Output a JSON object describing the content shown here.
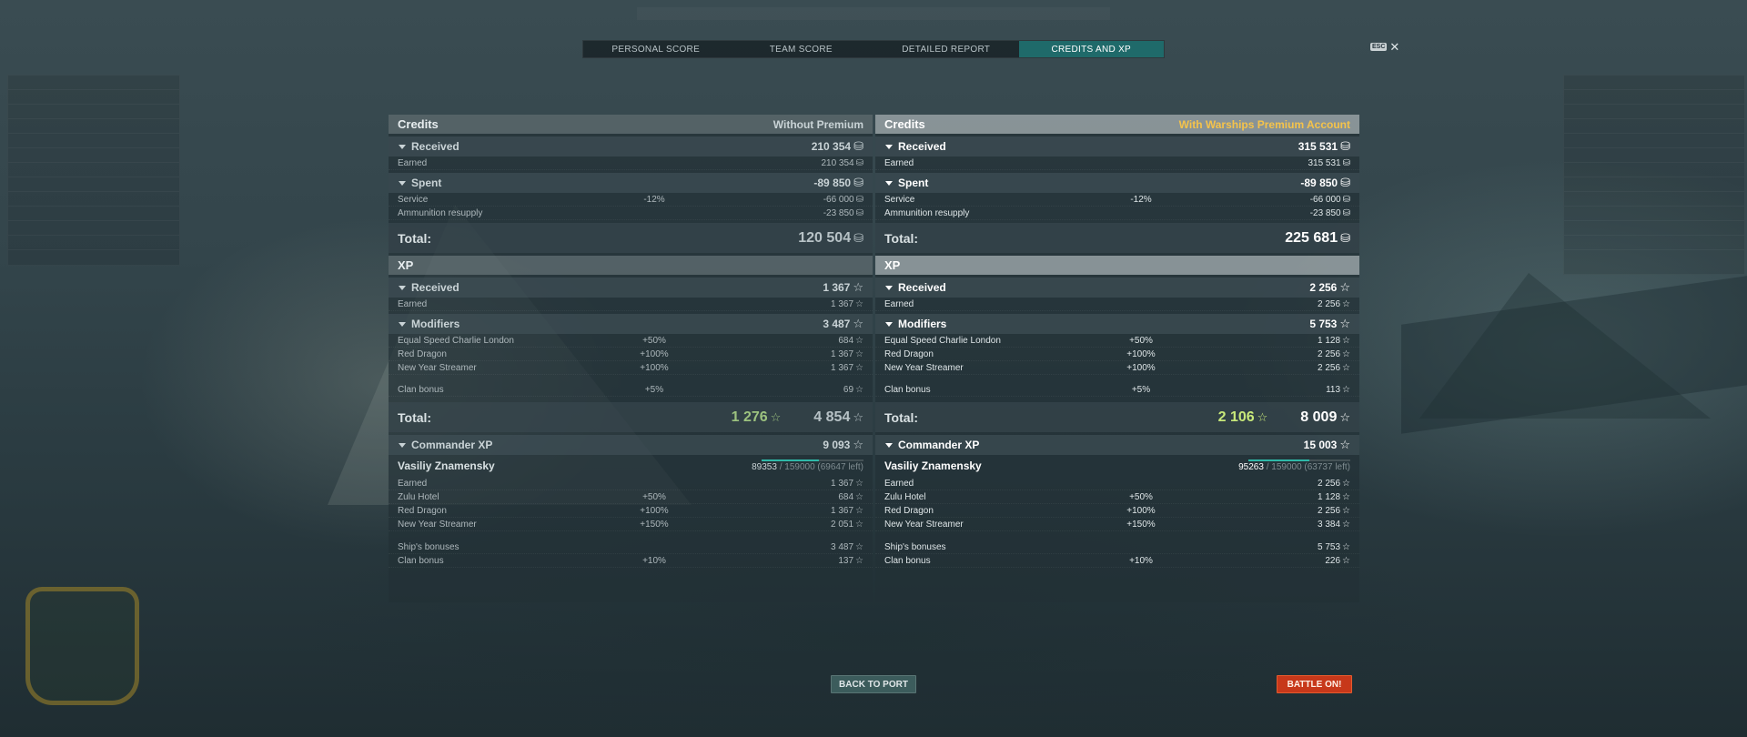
{
  "tabs": [
    {
      "label": "PERSONAL SCORE"
    },
    {
      "label": "TEAM SCORE"
    },
    {
      "label": "DETAILED REPORT"
    },
    {
      "label": "CREDITS AND XP"
    }
  ],
  "esc": {
    "badge": "ESC",
    "close": "✕"
  },
  "colors": {
    "accent": "#1f6a6a",
    "premium": "#f5c34a",
    "battle": "#c7381a",
    "xp_base": "#9cc27f"
  },
  "icons": {
    "credits": "credits-icon",
    "xp": "star-icon"
  },
  "left": {
    "credits_header": "Credits",
    "credits_sub": "Without Premium",
    "received": {
      "label": "Received",
      "value": "210 354"
    },
    "earned": {
      "label": "Earned",
      "value": "210 354"
    },
    "spent": {
      "label": "Spent",
      "value": "-89 850"
    },
    "service": {
      "label": "Service",
      "mod": "-12%",
      "value": "-66 000"
    },
    "ammo": {
      "label": "Ammunition resupply",
      "value": "-23 850"
    },
    "total_label": "Total:",
    "total_credits": "120 504",
    "xp_header": "XP",
    "xp_received": {
      "label": "Received",
      "value": "1 367"
    },
    "xp_earned": {
      "label": "Earned",
      "value": "1 367"
    },
    "modifiers": {
      "label": "Modifiers",
      "value": "3 487"
    },
    "mod_rows": [
      {
        "label": "Equal Speed Charlie London",
        "mod": "+50%",
        "value": "684"
      },
      {
        "label": "Red Dragon",
        "mod": "+100%",
        "value": "1 367"
      },
      {
        "label": "New Year Streamer",
        "mod": "+100%",
        "value": "1 367"
      }
    ],
    "clan_bonus": {
      "label": "Clan bonus",
      "mod": "+5%",
      "value": "69"
    },
    "xp_total_base": "1 276",
    "xp_total": "4 854",
    "commander": {
      "label": "Commander XP",
      "value": "9 093"
    },
    "cmd_name": "Vasiliy Znamensky",
    "cmd_progress": {
      "current": "89353",
      "rest": "/ 159000 (69647 left)",
      "fraction": 0.562
    },
    "cmd_rows": [
      {
        "label": "Earned",
        "mod": "",
        "value": "1 367"
      },
      {
        "label": "Zulu Hotel",
        "mod": "+50%",
        "value": "684"
      },
      {
        "label": "Red Dragon",
        "mod": "+100%",
        "value": "1 367"
      },
      {
        "label": "New Year Streamer",
        "mod": "+150%",
        "value": "2 051"
      }
    ],
    "ship_bonuses": {
      "label": "Ship's bonuses",
      "value": "3 487"
    },
    "cmd_clan": {
      "label": "Clan bonus",
      "mod": "+10%",
      "value": "137"
    }
  },
  "right": {
    "credits_header": "Credits",
    "credits_sub": "With Warships Premium Account",
    "received": {
      "label": "Received",
      "value": "315 531"
    },
    "earned": {
      "label": "Earned",
      "value": "315 531"
    },
    "spent": {
      "label": "Spent",
      "value": "-89 850"
    },
    "service": {
      "label": "Service",
      "mod": "-12%",
      "value": "-66 000"
    },
    "ammo": {
      "label": "Ammunition resupply",
      "value": "-23 850"
    },
    "total_label": "Total:",
    "total_credits": "225 681",
    "xp_header": "XP",
    "xp_received": {
      "label": "Received",
      "value": "2 256"
    },
    "xp_earned": {
      "label": "Earned",
      "value": "2 256"
    },
    "modifiers": {
      "label": "Modifiers",
      "value": "5 753"
    },
    "mod_rows": [
      {
        "label": "Equal Speed Charlie London",
        "mod": "+50%",
        "value": "1 128"
      },
      {
        "label": "Red Dragon",
        "mod": "+100%",
        "value": "2 256"
      },
      {
        "label": "New Year Streamer",
        "mod": "+100%",
        "value": "2 256"
      }
    ],
    "clan_bonus": {
      "label": "Clan bonus",
      "mod": "+5%",
      "value": "113"
    },
    "xp_total_base": "2 106",
    "xp_total": "8 009",
    "commander": {
      "label": "Commander XP",
      "value": "15 003"
    },
    "cmd_name": "Vasiliy Znamensky",
    "cmd_progress": {
      "current": "95263",
      "rest": "/ 159000 (63737 left)",
      "fraction": 0.599
    },
    "cmd_rows": [
      {
        "label": "Earned",
        "mod": "",
        "value": "2 256"
      },
      {
        "label": "Zulu Hotel",
        "mod": "+50%",
        "value": "1 128"
      },
      {
        "label": "Red Dragon",
        "mod": "+100%",
        "value": "2 256"
      },
      {
        "label": "New Year Streamer",
        "mod": "+150%",
        "value": "3 384"
      }
    ],
    "ship_bonuses": {
      "label": "Ship's bonuses",
      "value": "5 753"
    },
    "cmd_clan": {
      "label": "Clan bonus",
      "mod": "+10%",
      "value": "226"
    }
  },
  "buttons": {
    "back_to_port": "BACK TO PORT",
    "battle": "BATTLE ON!"
  }
}
